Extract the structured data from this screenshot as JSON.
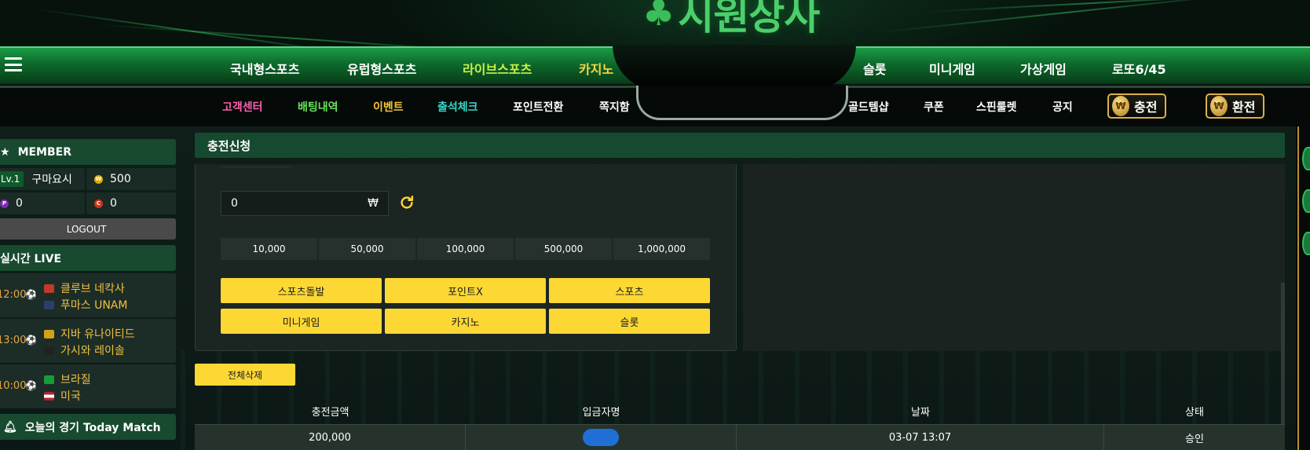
{
  "brand": {
    "logo_text": "시원상사"
  },
  "main_nav": {
    "items": [
      "국내형스포츠",
      "유럽형스포츠",
      "라이브스포츠",
      "카지노",
      "슬롯",
      "미니게임",
      "가상게임",
      "로또6/45"
    ],
    "colors": [
      "#ffffff",
      "#ffffff",
      "#c7f04a",
      "#f5d742",
      "#ffffff",
      "#ffffff",
      "#ffffff",
      "#ffffff"
    ]
  },
  "sub_nav": {
    "items": [
      "고객센터",
      "배팅내역",
      "이벤트",
      "출석체크",
      "포인트전환",
      "쪽지함",
      "골드템샵",
      "쿠폰",
      "스핀룰렛",
      "공지"
    ],
    "colors": [
      "#ff5fae",
      "#67e35b",
      "#f5c533",
      "#35d8c9",
      "#ffffff",
      "#ffffff",
      "#ffffff",
      "#ffffff",
      "#ffffff",
      "#ffffff"
    ],
    "charge_label": "충전",
    "exchange_label": "환전"
  },
  "sidebar": {
    "member_title": "MEMBER",
    "level": "Lv.1",
    "username": "구마요시",
    "money": "500",
    "point": "0",
    "coupon": "0",
    "logout_label": "LOGOUT",
    "live_title": "실시간 LIVE",
    "live_matches": [
      {
        "time": "12:00",
        "home": "클루브 네칵사",
        "away": "푸마스 UNAM"
      },
      {
        "time": "13:00",
        "home": "지바 유나이티드",
        "away": "가시와 레이솔"
      },
      {
        "time": "10:00",
        "home": "브라질",
        "away": "미국"
      }
    ],
    "today_title": "오늘의 경기 Today Match"
  },
  "deposit": {
    "title": "충전신청",
    "amount_value": "0",
    "currency_symbol": "₩",
    "quick_amounts": [
      "10,000",
      "50,000",
      "100,000",
      "500,000",
      "1,000,000"
    ],
    "bonus_options": [
      "스포츠돌발",
      "포인트X",
      "스포츠",
      "미니게임",
      "카지노",
      "슬롯"
    ],
    "delete_all_label": "전체삭제"
  },
  "history": {
    "columns": [
      "충전금액",
      "입금자명",
      "날짜",
      "상태"
    ],
    "rows": [
      {
        "amount": "200,000",
        "depositor": "",
        "date": "03-07 13:07",
        "status": "승인"
      }
    ]
  },
  "colors": {
    "accent_yellow": "#fdd835",
    "brand_green": "#164a30"
  }
}
